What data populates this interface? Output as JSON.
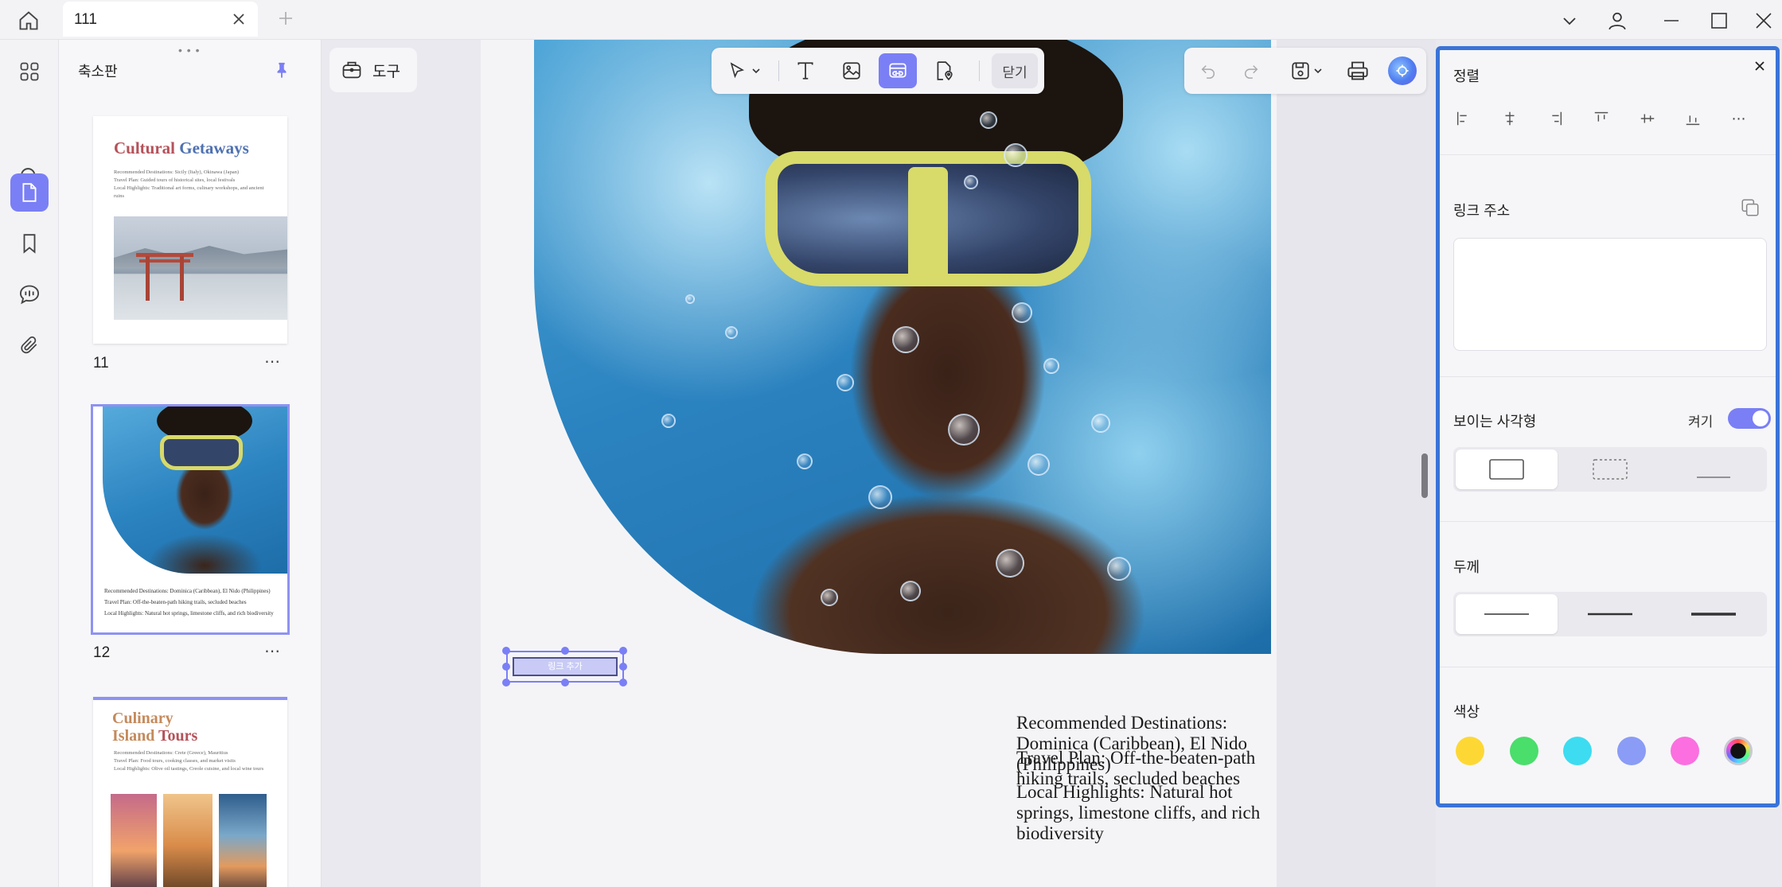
{
  "tab": {
    "title": "111"
  },
  "thumbnails": {
    "title": "축소판",
    "pages": [
      {
        "number": "11",
        "heading_a": "Cultural",
        "heading_b": "Getaways",
        "lines": [
          "Recommended Destinations: Sicily (Italy), Okinawa (Japan)",
          "Travel Plan: Guided tours of historical sites, local festivals",
          "Local Highlights: Traditional art forms, culinary workshops, and ancient ruins"
        ]
      },
      {
        "number": "12",
        "lines": [
          "Recommended Destinations: Dominica (Caribbean), El Nido (Philippines)",
          "Travel Plan: Off-the-beaten-path hiking trails, secluded beaches",
          "Local Highlights: Natural hot springs, limestone cliffs, and rich biodiversity"
        ]
      },
      {
        "heading_a": "Culinary",
        "heading_b": "Island",
        "heading_c": "Tours",
        "lines": [
          "Recommended Destinations: Crete (Greece), Mauritius",
          "Travel Plan: Food tours, cooking classes, and market visits",
          "Local Highlights: Olive oil tastings, Creole cuisine, and local wine tours"
        ]
      }
    ]
  },
  "tools": {
    "label": "도구"
  },
  "edit_toolbar": {
    "close_label": "닫기"
  },
  "link_annotation": {
    "label": "링크 추가"
  },
  "document": {
    "lines": [
      "Recommended Destinations: Dominica (Caribbean), El Nido (Philippines)",
      "Travel Plan: Off-the-beaten-path hiking trails, secluded beaches",
      "Local Highlights: Natural hot springs, limestone cliffs, and rich biodiversity"
    ]
  },
  "properties": {
    "align_title": "정렬",
    "link_title": "링크 주소",
    "link_value": "",
    "visible_rect_title": "보이는 사각형",
    "toggle_label": "켜기",
    "toggle_on": true,
    "thickness_title": "두께",
    "color_title": "색상",
    "colors": [
      "#fdd835",
      "#4ade6b",
      "#3ddcf0",
      "#8a9cf5",
      "#fb6fe0",
      "#111111"
    ],
    "selected_color": "#111111"
  },
  "accent_color": "#7a7ff5",
  "panel_border_color": "#3a73d8"
}
